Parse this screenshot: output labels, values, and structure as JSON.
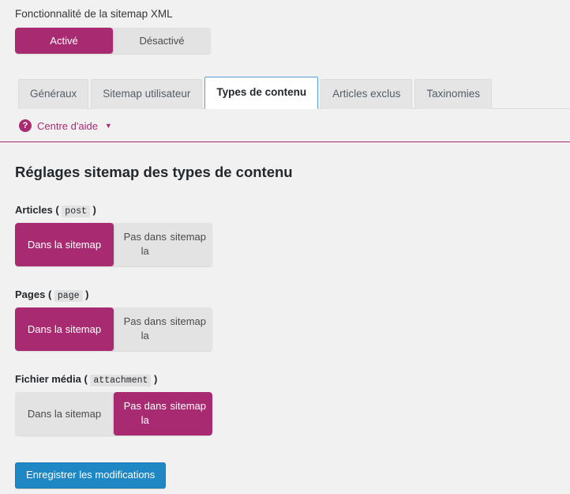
{
  "feature": {
    "title": "Fonctionnalité de la sitemap XML",
    "enabled_label": "Activé",
    "disabled_label": "Désactivé",
    "selected": "Activé"
  },
  "tabs": [
    {
      "label": "Généraux",
      "active": false
    },
    {
      "label": "Sitemap utilisateur",
      "active": false
    },
    {
      "label": "Types de contenu",
      "active": true
    },
    {
      "label": "Articles exclus",
      "active": false
    },
    {
      "label": "Taxinomies",
      "active": false
    }
  ],
  "help": {
    "icon": "question-mark-circle-icon",
    "label": "Centre d'aide",
    "caret": "▼"
  },
  "main": {
    "heading": "Réglages sitemap des types de contenu",
    "in_sitemap_label": "Dans la sitemap",
    "not_in_sitemap_line1": "Pas dans la",
    "not_in_sitemap_line2": "sitemap",
    "content_types": [
      {
        "name": "Articles",
        "slug": "post",
        "open_paren": "(",
        "close_paren": ")",
        "selected": "Dans la sitemap"
      },
      {
        "name": "Pages",
        "slug": "page",
        "open_paren": "(",
        "close_paren": ")",
        "selected": "Dans la sitemap"
      },
      {
        "name": "Fichier média",
        "slug": "attachment",
        "open_paren": "(",
        "close_paren": ")",
        "selected": "Pas dans la sitemap"
      }
    ]
  },
  "footer": {
    "save_label": "Enregistrer les modifications"
  },
  "colors": {
    "accent_magenta": "#a82b72",
    "button_blue": "#1e87c4",
    "active_tab_border": "#5b9dd9",
    "toggle_inactive": "#e3e3e3",
    "page_background": "#f1f1f1"
  }
}
